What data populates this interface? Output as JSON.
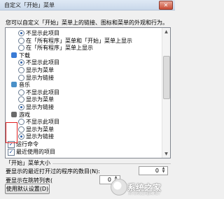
{
  "window": {
    "title": "自定义「开始」菜单",
    "close_glyph": "✕"
  },
  "description": "您可以自定义「开始」菜单上的链接、图标和菜单的外观和行为。",
  "list": {
    "items": [
      {
        "kind": "radio",
        "label": "不显示此项目",
        "checked": true
      },
      {
        "kind": "radio",
        "label": "在「所有程序」菜单和「开始」菜单上显示",
        "checked": false
      },
      {
        "kind": "radio",
        "label": "在「所有程序」菜单上显示",
        "checked": false
      },
      {
        "kind": "header",
        "label": "下载",
        "icon": "download-folder-icon"
      },
      {
        "kind": "radio",
        "label": "不显示此项目",
        "checked": true
      },
      {
        "kind": "radio",
        "label": "显示为菜单",
        "checked": false
      },
      {
        "kind": "radio",
        "label": "显示为链接",
        "checked": false
      },
      {
        "kind": "header",
        "label": "音乐",
        "icon": "music-icon"
      },
      {
        "kind": "radio",
        "label": "不显示此项目",
        "checked": false
      },
      {
        "kind": "radio",
        "label": "显示为菜单",
        "checked": false
      },
      {
        "kind": "radio",
        "label": "显示为链接",
        "checked": true
      },
      {
        "kind": "header",
        "label": "游戏",
        "icon": "games-icon"
      },
      {
        "kind": "radio",
        "label": "不显示此项目",
        "checked": false
      },
      {
        "kind": "radio",
        "label": "显示为菜单",
        "checked": false
      },
      {
        "kind": "radio",
        "label": "显示为链接",
        "checked": true
      },
      {
        "kind": "check",
        "label": "运行命令",
        "checked": true
      },
      {
        "kind": "check",
        "label": "最近使用的项目",
        "checked": true
      }
    ]
  },
  "menu_size": {
    "group_title": "「开始」菜单大小",
    "recent_programs_label": "要显示的最近打开过的程序的数目(N):",
    "recent_programs_value": "0",
    "jump_list_label": "要显示在跳转列表(",
    "jump_list_value": "0"
  },
  "buttons": {
    "defaults_label": "使用默认设置(D)"
  },
  "watermark": {
    "text": "系统之家",
    "sub": "XITONGZHIJIA.NET"
  },
  "colors": {
    "highlight_border": "#e02020"
  }
}
